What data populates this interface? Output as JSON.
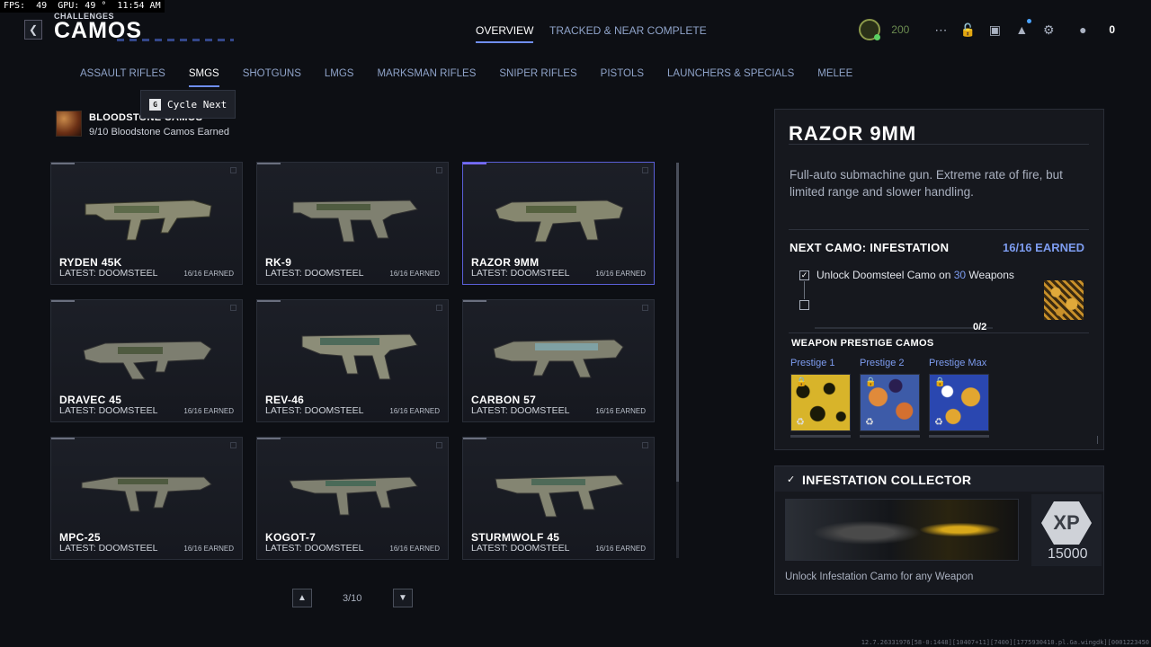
{
  "perf": {
    "text": "FPS:  49  GPU: 49 °  11:54 AM"
  },
  "header": {
    "breadcrumb": "CHALLENGES",
    "title": "CAMOS",
    "tabs": [
      {
        "label": "OVERVIEW",
        "active": true
      },
      {
        "label": "TRACKED & NEAR COMPLETE",
        "active": false
      }
    ],
    "level": "200",
    "friends_count": "0",
    "icons": [
      "player-level-icon",
      "grid-menu-icon",
      "unlock-icon",
      "camera-icon",
      "notifications-icon",
      "settings-icon",
      "friends-icon"
    ]
  },
  "categories": [
    {
      "label": "ASSAULT RIFLES",
      "active": false
    },
    {
      "label": "SMGS",
      "active": true
    },
    {
      "label": "SHOTGUNS",
      "active": false
    },
    {
      "label": "LMGS",
      "active": false
    },
    {
      "label": "MARKSMAN RIFLES",
      "active": false
    },
    {
      "label": "SNIPER RIFLES",
      "active": false
    },
    {
      "label": "PISTOLS",
      "active": false
    },
    {
      "label": "LAUNCHERS & SPECIALS",
      "active": false
    },
    {
      "label": "MELEE",
      "active": false
    }
  ],
  "tooltip": {
    "key": "G",
    "label": "Cycle Next"
  },
  "bloodstone": {
    "title": "BLOODSTONE CAMOS",
    "subtitle": "9/10 Bloodstone Camos Earned"
  },
  "weapons": [
    {
      "name": "RYDEN 45K",
      "latest": "LATEST: DOOMSTEEL",
      "earned": "16/16 EARNED"
    },
    {
      "name": "RK-9",
      "latest": "LATEST: DOOMSTEEL",
      "earned": "16/16 EARNED"
    },
    {
      "name": "RAZOR 9MM",
      "latest": "LATEST: DOOMSTEEL",
      "earned": "16/16 EARNED"
    },
    {
      "name": "DRAVEC 45",
      "latest": "LATEST: DOOMSTEEL",
      "earned": "16/16 EARNED"
    },
    {
      "name": "REV-46",
      "latest": "LATEST: DOOMSTEEL",
      "earned": "16/16 EARNED"
    },
    {
      "name": "CARBON 57",
      "latest": "LATEST: DOOMSTEEL",
      "earned": "16/16 EARNED"
    },
    {
      "name": "MPC-25",
      "latest": "LATEST: DOOMSTEEL",
      "earned": "16/16 EARNED"
    },
    {
      "name": "KOGOT-7",
      "latest": "LATEST: DOOMSTEEL",
      "earned": "16/16 EARNED"
    },
    {
      "name": "STURMWOLF 45",
      "latest": "LATEST: DOOMSTEEL",
      "earned": "16/16 EARNED"
    }
  ],
  "pager": {
    "text": "3/10",
    "up": "▲",
    "down": "▼"
  },
  "detail": {
    "title": "RAZOR 9MM",
    "description": "Full-auto submachine gun. Extreme rate of fire, but limited range and slower handling.",
    "next_camo_label": "NEXT CAMO: INFESTATION",
    "next_camo_earned": "16/16 EARNED",
    "task_prefix": "Unlock Doomsteel Camo on ",
    "task_count": "30",
    "task_suffix": " Weapons",
    "task_progress": "0/2",
    "prestige_heading": "WEAPON PRESTIGE CAMOS",
    "prestige_camos": [
      {
        "label": "Prestige 1"
      },
      {
        "label": "Prestige 2"
      },
      {
        "label": "Prestige Max"
      }
    ]
  },
  "collector": {
    "title": "INFESTATION COLLECTOR",
    "xp_label": "XP",
    "xp_amount": "15000",
    "description": "Unlock Infestation Camo for any Weapon"
  },
  "footer": {
    "debug": "12.7.26331976[58-0:1448][10407+11][7400][1775930410.pl.Ga.wingdk][0001223450"
  }
}
